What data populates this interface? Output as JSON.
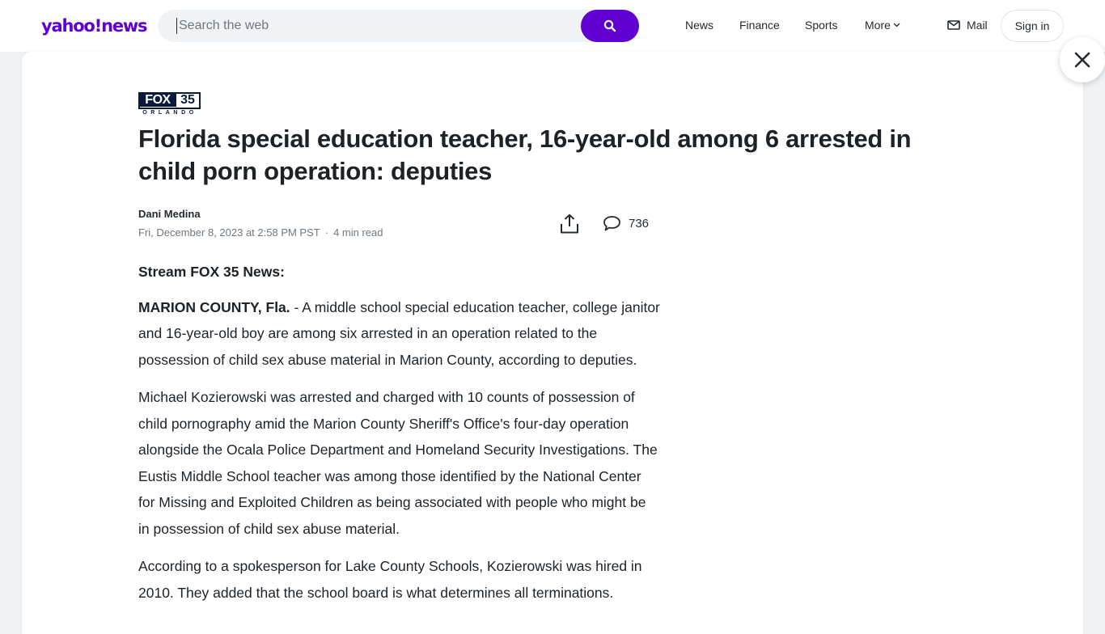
{
  "header": {
    "logo_main": "yahoo",
    "logo_bang": "!",
    "logo_section": "news",
    "search": {
      "placeholder": "Search the web",
      "value": "",
      "button_icon": "search-icon"
    },
    "nav": [
      {
        "label": "News"
      },
      {
        "label": "Finance"
      },
      {
        "label": "Sports"
      },
      {
        "label": "More"
      }
    ],
    "mail_label": "Mail",
    "signin_label": "Sign in"
  },
  "colors": {
    "brand": "#6001d2",
    "page_bg": "#f0f3f5",
    "text": "#232a31",
    "meta": "#6e7780"
  },
  "article": {
    "provider": {
      "name": "FOX",
      "channel": "35",
      "city": "ORLANDO"
    },
    "title": "Florida special education teacher, 16-year-old among 6 arrested in child porn operation: deputies",
    "author": "Dani Medina",
    "date": "Fri, December 8, 2023 at 2:58 PM PST",
    "read_time": "4 min read",
    "comment_count": "736",
    "stream_label": "Stream FOX 35 News:",
    "lead_place": "MARION COUNTY, Fla.",
    "lead_text": " - A middle school special education teacher, college janitor and 16-year-old boy are among six arrested in an operation related to the possession of child sex abuse material in Marion County, according to deputies.",
    "paragraph_2": "Michael Kozierowski was arrested and charged with 10 counts of possession of child pornography amid the Marion County Sheriff's Office's four-day operation alongside the Ocala Police Department and Homeland Security Investigations. The Eustis Middle School teacher was among those identified by the National Center for Missing and Exploited Children as being associated with people who might be in possession of child sex abuse material.",
    "paragraph_3": "According to a spokesperson for Lake County Schools, Kozierowski was hired in 2010. They added that the school board is what determines all terminations."
  }
}
